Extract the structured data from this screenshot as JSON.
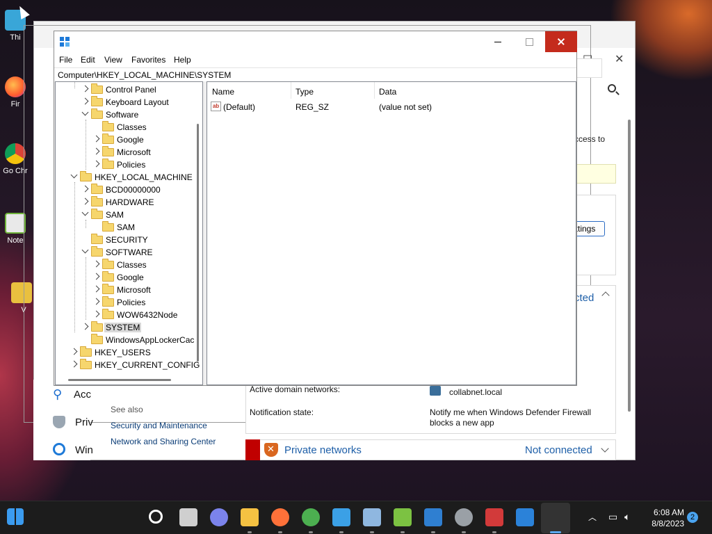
{
  "desktop": {
    "icons": [
      {
        "label": "Thi",
        "icon": "this-pc-icon"
      },
      {
        "label": "Fir",
        "icon": "firefox-icon"
      },
      {
        "label": "Go Chr",
        "icon": "chrome-icon"
      },
      {
        "label": "Note",
        "icon": "notepad-icon"
      },
      {
        "label": "V",
        "icon": "folder-icon"
      }
    ]
  },
  "firewall_window": {
    "access_text": "ccess to",
    "settings_button": "ettings",
    "connected_text": "cted",
    "partial_n": "n",
    "left_items": [
      "Acc",
      "Priv",
      "Win"
    ],
    "see_also": "See also",
    "links": [
      "Security and Maintenance",
      "Network and Sharing Center"
    ],
    "active_domain_label": "Active domain networks:",
    "active_domain_value": "collabnet.local",
    "notification_label": "Notification state:",
    "notification_value": "Notify me when Windows Defender Firewall blocks a new app",
    "private_networks": "Private networks",
    "private_status": "Not connected"
  },
  "regedit": {
    "menu": [
      "File",
      "Edit",
      "View",
      "Favorites",
      "Help"
    ],
    "address": "Computer\\HKEY_LOCAL_MACHINE\\SYSTEM",
    "tree": [
      {
        "label": "Control Panel",
        "level": 1,
        "exp": "closed"
      },
      {
        "label": "Keyboard Layout",
        "level": 1,
        "exp": "closed"
      },
      {
        "label": "Software",
        "level": 1,
        "exp": "open"
      },
      {
        "label": "Classes",
        "level": 2,
        "exp": "none"
      },
      {
        "label": "Google",
        "level": 2,
        "exp": "closed"
      },
      {
        "label": "Microsoft",
        "level": 2,
        "exp": "closed"
      },
      {
        "label": "Policies",
        "level": 2,
        "exp": "closed"
      },
      {
        "label": "HKEY_LOCAL_MACHINE",
        "level": 0,
        "exp": "open"
      },
      {
        "label": "BCD00000000",
        "level": 1,
        "exp": "closed"
      },
      {
        "label": "HARDWARE",
        "level": 1,
        "exp": "closed"
      },
      {
        "label": "SAM",
        "level": 1,
        "exp": "open"
      },
      {
        "label": "SAM",
        "level": 2,
        "exp": "none"
      },
      {
        "label": "SECURITY",
        "level": 1,
        "exp": "none"
      },
      {
        "label": "SOFTWARE",
        "level": 1,
        "exp": "open"
      },
      {
        "label": "Classes",
        "level": 2,
        "exp": "closed"
      },
      {
        "label": "Google",
        "level": 2,
        "exp": "closed"
      },
      {
        "label": "Microsoft",
        "level": 2,
        "exp": "closed"
      },
      {
        "label": "Policies",
        "level": 2,
        "exp": "closed"
      },
      {
        "label": "WOW6432Node",
        "level": 2,
        "exp": "closed"
      },
      {
        "label": "SYSTEM",
        "level": 1,
        "exp": "closed",
        "selected": true
      },
      {
        "label": "WindowsAppLockerCac",
        "level": 1,
        "exp": "none"
      },
      {
        "label": "HKEY_USERS",
        "level": 0,
        "exp": "closed"
      },
      {
        "label": "HKEY_CURRENT_CONFIG",
        "level": 0,
        "exp": "closed"
      }
    ],
    "columns": [
      "Name",
      "Type",
      "Data"
    ],
    "values": [
      {
        "name": "(Default)",
        "type": "REG_SZ",
        "data": "(value not set)"
      }
    ]
  },
  "taskbar": {
    "apps": [
      {
        "name": "start",
        "color": "#3b9bef"
      },
      {
        "name": "search",
        "color": "#ffffff"
      },
      {
        "name": "task-view",
        "color": "#cfcfcf"
      },
      {
        "name": "teams-chat",
        "color": "#7b83eb"
      },
      {
        "name": "file-explorer",
        "color": "#f5c242"
      },
      {
        "name": "firefox",
        "color": "#ff7139"
      },
      {
        "name": "chrome",
        "color": "#4caf50"
      },
      {
        "name": "app-blue",
        "color": "#3ba0e6"
      },
      {
        "name": "resource-monitor",
        "color": "#8fb7e0"
      },
      {
        "name": "notepadpp",
        "color": "#7cc242"
      },
      {
        "name": "remote-desktop",
        "color": "#2f7fd1"
      },
      {
        "name": "settings",
        "color": "#9aa0a6"
      },
      {
        "name": "toolbox",
        "color": "#d23a3a"
      },
      {
        "name": "regedit",
        "color": "#2b82d9"
      }
    ],
    "time": "6:08 AM",
    "date": "8/8/2023",
    "notifications": "2"
  }
}
